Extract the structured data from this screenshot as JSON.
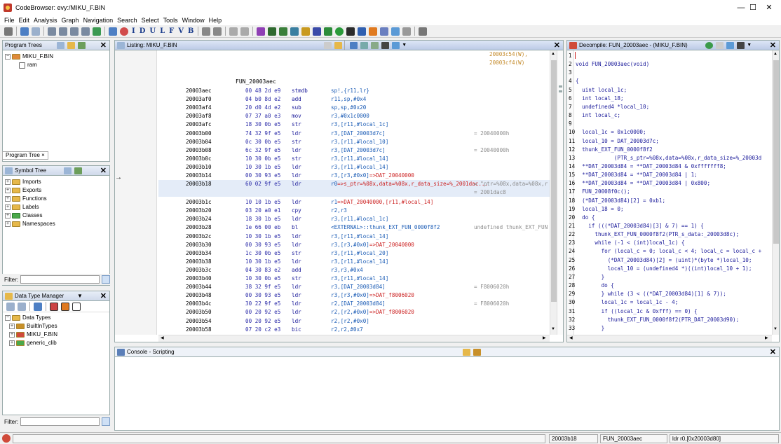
{
  "window": {
    "title": "CodeBrowser: evy:/MIKU_F.BIN",
    "minimize": "—",
    "maximize": "☐",
    "close": "✕"
  },
  "menu": [
    "File",
    "Edit",
    "Analysis",
    "Graph",
    "Navigation",
    "Search",
    "Select",
    "Tools",
    "Window",
    "Help"
  ],
  "toolbar_letters": [
    "I",
    "D",
    "U",
    "L",
    "F",
    "V",
    "B"
  ],
  "program_trees": {
    "title": "Program Trees",
    "root": "MIKU_F.BIN",
    "child": "ram",
    "tab": "Program Tree ×"
  },
  "symbol_tree": {
    "title": "Symbol Tree",
    "items": [
      "Imports",
      "Exports",
      "Functions",
      "Labels",
      "Classes",
      "Namespaces"
    ],
    "filter_label": "Filter:"
  },
  "data_type_manager": {
    "title": "Data Type Manager",
    "root": "Data Types",
    "items": [
      "BuiltInTypes",
      "MIKU_F.BIN",
      "generic_clib"
    ],
    "filter_label": "Filter:"
  },
  "listing": {
    "title": "Listing:  MIKU_F.BIN",
    "xrefs_top": [
      "20003c54(W),",
      "20003cf4(W)"
    ],
    "function_label": "FUN_20003aec",
    "rows": [
      {
        "addr": "20003aec",
        "bytes": "00 48 2d e9",
        "mn": "stmdb",
        "op": "sp!,{r11,lr}",
        "cm": ""
      },
      {
        "addr": "20003af0",
        "bytes": "04 b0 8d e2",
        "mn": "add",
        "op": "r11,sp,#0x4",
        "cm": ""
      },
      {
        "addr": "20003af4",
        "bytes": "20 d0 4d e2",
        "mn": "sub",
        "op": "sp,sp,#0x20",
        "cm": ""
      },
      {
        "addr": "20003af8",
        "bytes": "07 37 a0 e3",
        "mn": "mov",
        "op": "r3,#0x1c0000",
        "cm": ""
      },
      {
        "addr": "20003afc",
        "bytes": "18 30 0b e5",
        "mn": "str",
        "op": "r3,[r11,#local_1c]",
        "cm": ""
      },
      {
        "addr": "20003b00",
        "bytes": "74 32 9f e5",
        "mn": "ldr",
        "op": "r3,[DAT_20003d7c]",
        "cm": "= 20040000h"
      },
      {
        "addr": "20003b04",
        "bytes": "0c 30 0b e5",
        "mn": "str",
        "op": "r3,[r11,#local_10]",
        "cm": ""
      },
      {
        "addr": "20003b08",
        "bytes": "6c 32 9f e5",
        "mn": "ldr",
        "op": "r3,[DAT_20003d7c]",
        "cm": "= 20040000h"
      },
      {
        "addr": "20003b0c",
        "bytes": "10 30 0b e5",
        "mn": "str",
        "op": "r3,[r11,#local_14]",
        "cm": ""
      },
      {
        "addr": "20003b10",
        "bytes": "10 30 1b e5",
        "mn": "ldr",
        "op": "r3,[r11,#local_14]",
        "cm": ""
      },
      {
        "addr": "20003b14",
        "bytes": "00 30 93 e5",
        "mn": "ldr",
        "op": "r3,[r3,#0x0]=>DAT_20040000",
        "cm": ""
      },
      {
        "addr": "20003b18",
        "bytes": "60 02 9f e5",
        "mn": "ldr",
        "op": "r0=>s_ptr=%08x,data=%08x,r_data_size=%_2001dac...",
        "cm": "= \"ptr=%08x,data=%08x,r",
        "cm2": "= 2001dac8",
        "hl": true
      },
      {
        "addr": "20003b1c",
        "bytes": "10 10 1b e5",
        "mn": "ldr",
        "op": "r1=>DAT_20040000,[r11,#local_14]",
        "cm": ""
      },
      {
        "addr": "20003b20",
        "bytes": "03 20 a0 e1",
        "mn": "cpy",
        "op": "r2,r3",
        "cm": ""
      },
      {
        "addr": "20003b24",
        "bytes": "18 30 1b e5",
        "mn": "ldr",
        "op": "r3,[r11,#local_1c]",
        "cm": ""
      },
      {
        "addr": "20003b28",
        "bytes": "1e 66 00 eb",
        "mn": "bl",
        "op": "<EXTERNAL>::thunk_EXT_FUN_0000f8f2",
        "cm": "undefined thunk_EXT_FUN"
      },
      {
        "addr": "20003b2c",
        "bytes": "10 30 1b e5",
        "mn": "ldr",
        "op": "r3,[r11,#local_14]",
        "cm": ""
      },
      {
        "addr": "20003b30",
        "bytes": "00 30 93 e5",
        "mn": "ldr",
        "op": "r3,[r3,#0x0]=>DAT_20040000",
        "cm": ""
      },
      {
        "addr": "20003b34",
        "bytes": "1c 30 0b e5",
        "mn": "str",
        "op": "r3,[r11,#local_20]",
        "cm": ""
      },
      {
        "addr": "20003b38",
        "bytes": "10 30 1b e5",
        "mn": "ldr",
        "op": "r3,[r11,#local_14]",
        "cm": ""
      },
      {
        "addr": "20003b3c",
        "bytes": "04 30 83 e2",
        "mn": "add",
        "op": "r3,r3,#0x4",
        "cm": ""
      },
      {
        "addr": "20003b40",
        "bytes": "10 30 0b e5",
        "mn": "str",
        "op": "r3,[r11,#local_14]",
        "cm": ""
      },
      {
        "addr": "20003b44",
        "bytes": "38 32 9f e5",
        "mn": "ldr",
        "op": "r3,[DAT_20003d84]",
        "cm": "= F8006020h"
      },
      {
        "addr": "20003b48",
        "bytes": "00 30 93 e5",
        "mn": "ldr",
        "op": "r3,[r3,#0x0]=>DAT_f8006020",
        "cm": ""
      },
      {
        "addr": "20003b4c",
        "bytes": "30 22 9f e5",
        "mn": "ldr",
        "op": "r2,[DAT_20003d84]",
        "cm": "= F8006020h"
      },
      {
        "addr": "20003b50",
        "bytes": "00 20 92 e5",
        "mn": "ldr",
        "op": "r2,[r2,#0x0]=>DAT_f8006020",
        "cm": ""
      },
      {
        "addr": "20003b54",
        "bytes": "00 20 92 e5",
        "mn": "ldr",
        "op": "r2,[r2,#0x0]",
        "cm": ""
      },
      {
        "addr": "20003b58",
        "bytes": "07 20 c2 e3",
        "mn": "bic",
        "op": "r2,r2,#0x7",
        "cm": ""
      },
      {
        "addr": "20003b5c",
        "bytes": "00 20 83 e5",
        "mn": "str",
        "op": "r2,[r3,#0x0]",
        "cm": ""
      }
    ]
  },
  "decompile": {
    "title": "Decompile: FUN_20003aec -  (MIKU_F.BIN)",
    "lines": [
      {
        "n": "1",
        "t": ""
      },
      {
        "n": "2",
        "t": "void FUN_20003aec(void)"
      },
      {
        "n": "3",
        "t": ""
      },
      {
        "n": "4",
        "t": "{"
      },
      {
        "n": "5",
        "t": "  uint local_1c;"
      },
      {
        "n": "6",
        "t": "  int local_18;"
      },
      {
        "n": "7",
        "t": "  undefined4 *local_10;"
      },
      {
        "n": "8",
        "t": "  int local_c;"
      },
      {
        "n": "9",
        "t": ""
      },
      {
        "n": "10",
        "t": "  local_1c = 0x1c0000;"
      },
      {
        "n": "11",
        "t": "  local_10 = DAT_20003d7c;"
      },
      {
        "n": "12",
        "t": "  thunk_EXT_FUN_0000f8f2"
      },
      {
        "n": "13",
        "t": "            (PTR_s_ptr=%08x,data=%08x,r_data_size=%_20003d"
      },
      {
        "n": "14",
        "t": "  **DAT_20003d84 = **DAT_20003d84 & 0xfffffff8;"
      },
      {
        "n": "15",
        "t": "  **DAT_20003d84 = **DAT_20003d84 | 1;"
      },
      {
        "n": "16",
        "t": "  **DAT_20003d84 = **DAT_20003d84 | 0x800;"
      },
      {
        "n": "17",
        "t": "  FUN_20008f0c();"
      },
      {
        "n": "18",
        "t": "  (*DAT_20003d84)[2] = 0xb1;"
      },
      {
        "n": "19",
        "t": "  local_18 = 0;"
      },
      {
        "n": "20",
        "t": "  do {"
      },
      {
        "n": "21",
        "t": "    if (((*DAT_20003d84)[3] & 7) == 1) {"
      },
      {
        "n": "22",
        "t": "      thunk_EXT_FUN_0000f8f2(PTR_s_data:_20003d8c);"
      },
      {
        "n": "23",
        "t": "      while (-1 < (int)local_1c) {"
      },
      {
        "n": "24",
        "t": "        for (local_c = 0; local_c < 4; local_c = local_c +"
      },
      {
        "n": "25",
        "t": "          (*DAT_20003d84)[2] = (uint)*(byte *)local_10;"
      },
      {
        "n": "26",
        "t": "          local_10 = (undefined4 *)((int)local_10 + 1);"
      },
      {
        "n": "27",
        "t": "        }"
      },
      {
        "n": "28",
        "t": "        do {"
      },
      {
        "n": "29",
        "t": "        } while (3 < ((*DAT_20003d84)[1] & 7));"
      },
      {
        "n": "30",
        "t": "        local_1c = local_1c - 4;"
      },
      {
        "n": "31",
        "t": "        if ((local_1c & 0xfff) == 0) {"
      },
      {
        "n": "32",
        "t": "          thunk_EXT_FUN_0000f8f2(PTR_DAT_20003d90);"
      },
      {
        "n": "33",
        "t": "        }"
      }
    ]
  },
  "console": {
    "title": "Console - Scripting"
  },
  "status": {
    "address": "20003b18",
    "function": "FUN_20003aec",
    "instruction": "ldr r0,[0x20003d80]"
  },
  "colors": {
    "highlight_row": "#e4ecf8",
    "selection_blue": "#3d6fb8",
    "mnemonic": "#1a1a9a"
  }
}
